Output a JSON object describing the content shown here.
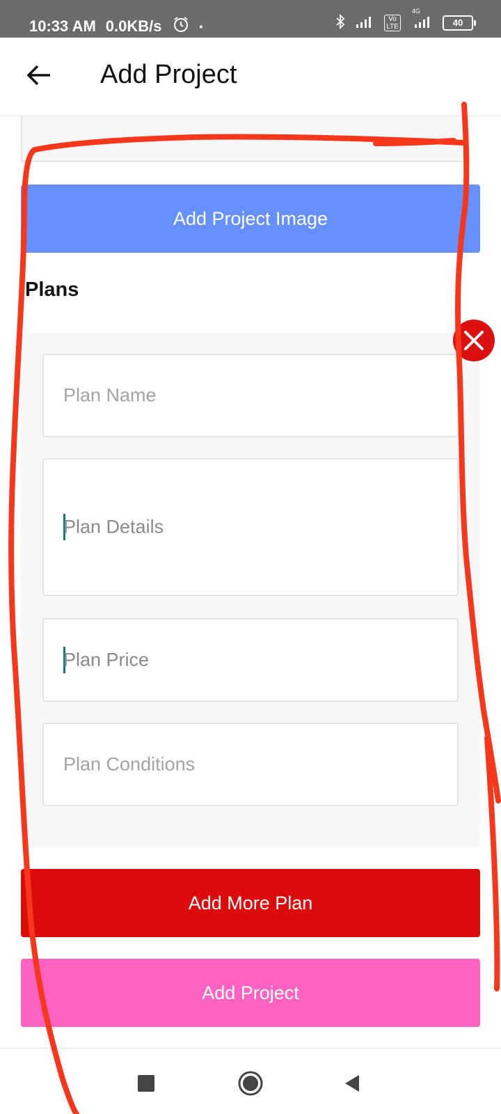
{
  "status_bar": {
    "time": "10:33 AM",
    "speed": "0.0KB/s",
    "dot": "•",
    "volte": "Vo LTE",
    "network": "4G",
    "battery": "40"
  },
  "header": {
    "title": "Add Project",
    "back_icon": "arrow-left-icon"
  },
  "buttons": {
    "add_image": "Add Project Image",
    "add_more_plan": "Add More Plan",
    "add_project": "Add Project"
  },
  "plans": {
    "title": "Plans",
    "fields": {
      "name_placeholder": "Plan Name",
      "details_placeholder": "Plan Details",
      "price_placeholder": "Plan Price",
      "conditions_placeholder": "Plan Conditions"
    },
    "remove_icon": "close-icon"
  },
  "nav": {
    "recents_icon": "square-icon",
    "home_icon": "circle-icon",
    "back_icon": "triangle-back-icon"
  },
  "colors": {
    "add_image_button": "#6690ff",
    "add_more_plan_button": "#dd0c0c",
    "add_project_button": "#ff63c2",
    "annotation": "#f6371b",
    "remove_button": "#dd1010"
  }
}
